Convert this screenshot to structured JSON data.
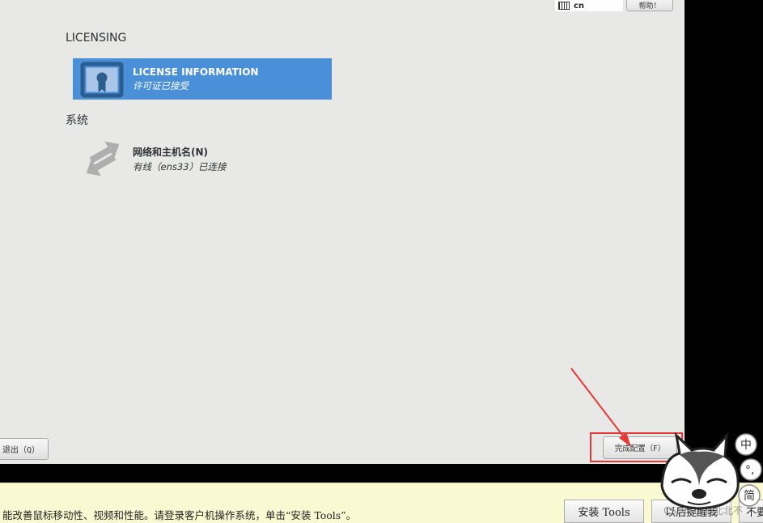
{
  "topbar": {
    "keyboard_layout": "cn",
    "help_label": "帮助！"
  },
  "sections": [
    {
      "title": "LICENSING",
      "spokes": [
        {
          "title": "LICENSE INFORMATION",
          "status": "许可证已接受",
          "icon": "license-certificate-icon",
          "selected": true
        }
      ]
    },
    {
      "title": "系统",
      "spokes": [
        {
          "title": "网络和主机名(N)",
          "status": "有线（ens33）已连接",
          "icon": "network-arrows-icon",
          "selected": false
        }
      ]
    }
  ],
  "buttons": {
    "quit": "退出（Q）",
    "finish": "完成配置（F）"
  },
  "vmware_bar": {
    "message": "能改善鼠标移动性、视频和性能。请登录客户机操作系统，单击“安装 Tools”。",
    "install_tools": "安装 Tools",
    "remind_later": "以后提醒我",
    "never_remind": "不要"
  },
  "side_bubbles": [
    "中",
    "°,",
    "简"
  ],
  "watermark": "CSDN @我北北不"
}
